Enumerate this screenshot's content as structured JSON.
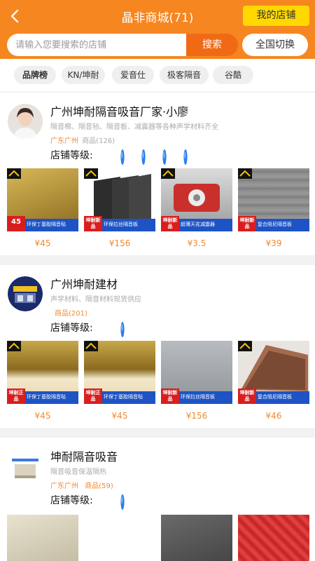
{
  "header": {
    "title": "晶非商城(71)",
    "my_store": "我的店铺"
  },
  "search": {
    "placeholder": "请输入您要搜索的店铺",
    "search_label": "搜索",
    "switch_label": "全国切换"
  },
  "tags": [
    "品牌榜",
    "KN/坤耐",
    "爱音仕",
    "极客隔音",
    "谷酷"
  ],
  "level_label": "店铺等级:",
  "shops": [
    {
      "name": "广州坤耐隔音吸音厂家·小廖",
      "desc": "隔音棉、隔音毡、隔音板、减震器等各种声学材料齐全",
      "location": "广东广州",
      "goods": "商品(126)",
      "level": 4,
      "products": [
        {
          "label": "环保丁基胶隔音毡",
          "price": "¥45",
          "badge": "45",
          "colors": [
            "#c8a84a",
            "#8a6a20"
          ]
        },
        {
          "label": "环保拉丝隔音板",
          "price": "¥156",
          "badge": "坤耐新品",
          "colors": [
            "#3a3a3a",
            "#bfc4c9"
          ]
        },
        {
          "label": "超薄天花减震器",
          "price": "¥3.5",
          "badge": "坤耐新品",
          "colors": [
            "#c9302c",
            "#d8d8d8"
          ]
        },
        {
          "label": "复合阻尼隔音板",
          "price": "¥39",
          "badge": "坤耐新品",
          "colors": [
            "#8a8a8a",
            "#b0b0b0"
          ]
        }
      ]
    },
    {
      "name": "广州坤耐建材",
      "desc": "声学材料、隔音材料现货供应",
      "location": "",
      "goods": "商品(201)",
      "level": 1,
      "products": [
        {
          "label": "环保丁基胶隔音毡",
          "price": "¥45",
          "badge": "坤耐正品",
          "colors": [
            "#c8a84a",
            "#f2e7c9"
          ]
        },
        {
          "label": "环保丁基胶隔音毡",
          "price": "¥45",
          "badge": "坤耐正品",
          "colors": [
            "#c8a84a",
            "#f2e7c9"
          ]
        },
        {
          "label": "环保拉丝隔音板",
          "price": "¥156",
          "badge": "坤耐新品",
          "colors": [
            "#9aa0a6",
            "#c7cbcf"
          ]
        },
        {
          "label": "复合阻尼隔音板",
          "price": "¥46",
          "badge": "坤耐新品",
          "colors": [
            "#a56a4e",
            "#c9b6a8"
          ]
        }
      ]
    },
    {
      "name": "坤耐隔音吸音",
      "desc": "隔音吸音保温隔热",
      "location": "广东广州",
      "goods": "商品(59)",
      "level": 1,
      "products": [
        {
          "label": "",
          "price": "",
          "badge": "",
          "colors": [
            "#d9d3c0",
            "#8a8a80"
          ]
        },
        {
          "label": "",
          "price": "",
          "badge": "",
          "colors": [
            "#555",
            "#777"
          ]
        },
        {
          "label": "",
          "price": "",
          "badge": "",
          "colors": [
            "#c22",
            "#e55"
          ]
        }
      ]
    }
  ]
}
